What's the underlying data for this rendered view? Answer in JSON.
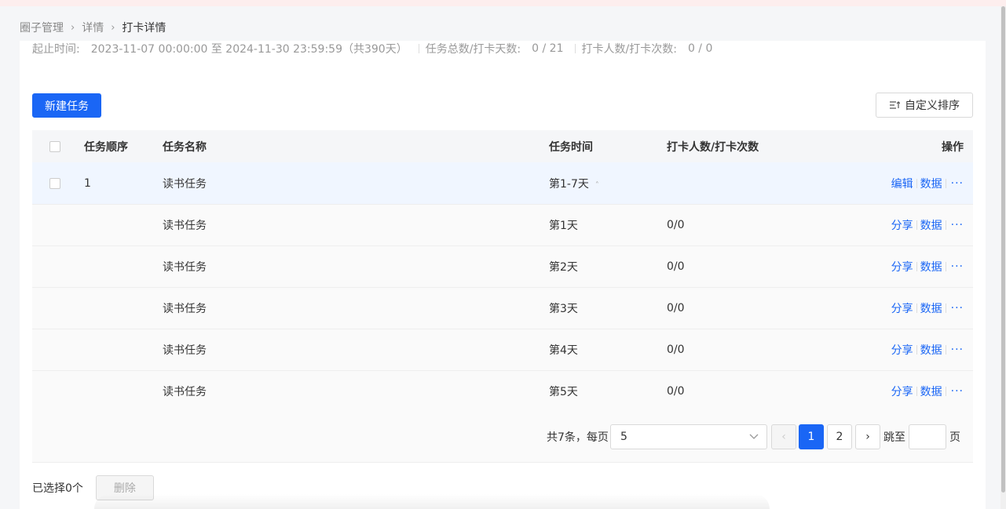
{
  "breadcrumb": [
    "圈子管理",
    "详情",
    "打卡详情"
  ],
  "info": {
    "period_label": "起止时间:",
    "period_value": "2023-11-07 00:00:00 至 2024-11-30 23:59:59（共390天）",
    "tasks_label": "任务总数/打卡天数:",
    "tasks_value": "0 / 21",
    "checkins_label": "打卡人数/打卡次数:",
    "checkins_value": "0 / 0"
  },
  "toolbar": {
    "new_task": "新建任务",
    "custom_sort": "自定义排序"
  },
  "table": {
    "columns": [
      "任务顺序",
      "任务名称",
      "任务时间",
      "打卡人数/打卡次数",
      "操作"
    ],
    "parent_row": {
      "order": "1",
      "name": "读书任务",
      "time": "第1-7天",
      "count": "",
      "ops": [
        "编辑",
        "数据",
        "···"
      ]
    },
    "child_rows": [
      {
        "name": "读书任务",
        "time": "第1天",
        "count": "0/0",
        "ops": [
          "分享",
          "数据",
          "···"
        ]
      },
      {
        "name": "读书任务",
        "time": "第2天",
        "count": "0/0",
        "ops": [
          "分享",
          "数据",
          "···"
        ]
      },
      {
        "name": "读书任务",
        "time": "第3天",
        "count": "0/0",
        "ops": [
          "分享",
          "数据",
          "···"
        ]
      },
      {
        "name": "读书任务",
        "time": "第4天",
        "count": "0/0",
        "ops": [
          "分享",
          "数据",
          "···"
        ]
      },
      {
        "name": "读书任务",
        "time": "第5天",
        "count": "0/0",
        "ops": [
          "分享",
          "数据",
          "···"
        ]
      }
    ]
  },
  "pagination": {
    "total_text": "共7条，每页",
    "page_size": "5",
    "pages": [
      "1",
      "2"
    ],
    "current_page": "1",
    "jump_label": "跳至",
    "page_suffix": "页"
  },
  "footer": {
    "selected_text": "已选择0个",
    "delete_label": "删除"
  },
  "colors": {
    "primary": "#1a66f5",
    "row_highlight": "#f0f6ff"
  }
}
